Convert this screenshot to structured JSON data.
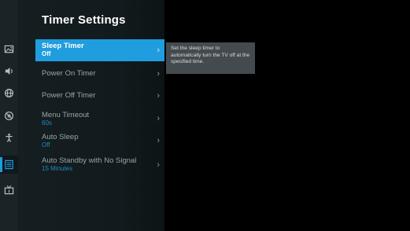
{
  "panel": {
    "title": "Timer Settings"
  },
  "rail": {
    "icons": [
      "picture-icon",
      "sound-icon",
      "network-icon",
      "general-icon",
      "accessibility-icon",
      "timer-settings-icon",
      "channel-icon"
    ],
    "active_index": 5
  },
  "menu": {
    "items": [
      {
        "label": "Sleep Timer",
        "value": "Off",
        "selected": true
      },
      {
        "label": "Power On Timer",
        "value": ""
      },
      {
        "label": "Power Off Timer",
        "value": ""
      },
      {
        "label": "Menu Timeout",
        "value": "60s"
      },
      {
        "label": "Auto Sleep",
        "value": "Off"
      },
      {
        "label": "Auto Standby with No Signal",
        "value": "15 Minutes"
      }
    ]
  },
  "help": {
    "text": "Set the sleep timer to automatically turn the TV off at the specified time."
  },
  "colors": {
    "accent": "#1f9dde",
    "value_text": "#1e8cbf",
    "panel_bg": "#151e21",
    "rail_bg": "#1a2326",
    "help_bg": "#444b4e"
  }
}
